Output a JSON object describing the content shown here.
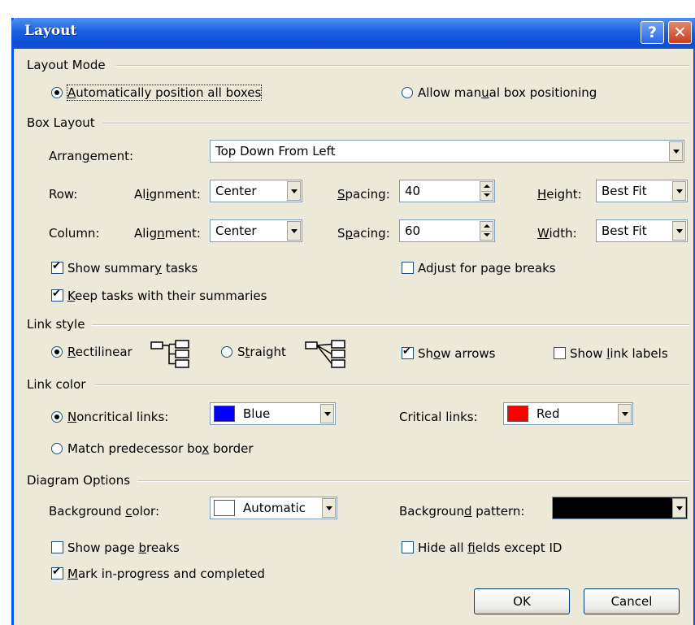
{
  "window": {
    "title": "Layout",
    "help_glyph": "?",
    "close_glyph": "✕"
  },
  "layout_mode": {
    "heading": "Layout Mode",
    "auto": {
      "pre": "",
      "key": "A",
      "post": "utomatically position all boxes",
      "selected": true
    },
    "manual": {
      "pre": "Allow man",
      "key": "u",
      "post": "al box positioning",
      "selected": false
    }
  },
  "box_layout": {
    "heading": "Box Layout",
    "arrangement": {
      "pre": "Arran",
      "key": "g",
      "post": "ement:",
      "value": "Top Down From Left"
    },
    "row": {
      "label": "Row:",
      "alignment": {
        "pre": "Al",
        "key": "i",
        "post": "gnment:",
        "value": "Center"
      },
      "spacing": {
        "pre": "",
        "key": "S",
        "post": "pacing:",
        "value": "40"
      },
      "size": {
        "pre": "",
        "key": "H",
        "post": "eight:",
        "value": "Best Fit"
      }
    },
    "column": {
      "label": "Column:",
      "alignment": {
        "pre": "Alig",
        "key": "n",
        "post": "ment:",
        "value": "Center"
      },
      "spacing": {
        "pre": "S",
        "key": "p",
        "post": "acing:",
        "value": "60"
      },
      "size": {
        "pre": "",
        "key": "W",
        "post": "idth:",
        "value": "Best Fit"
      }
    },
    "show_summary": {
      "pre": "Show summar",
      "key": "y",
      "post": " tasks",
      "checked": true
    },
    "keep_tasks": {
      "pre": "",
      "key": "K",
      "post": "eep tasks with their summaries",
      "checked": true
    },
    "adjust_breaks": {
      "pre": "Ad",
      "key": "j",
      "post": "ust for page breaks",
      "checked": false
    }
  },
  "link_style": {
    "heading": "Link style",
    "rectilinear": {
      "pre": "",
      "key": "R",
      "post": "ectilinear",
      "selected": true
    },
    "straight": {
      "pre": "S",
      "key": "t",
      "post": "raight",
      "selected": false
    },
    "show_arrows": {
      "pre": "Sh",
      "key": "o",
      "post": "w arrows",
      "checked": true
    },
    "show_labels": {
      "pre": "Show ",
      "key": "l",
      "post": "ink labels",
      "checked": false
    },
    "icons": [
      "rectilinear-link-icon",
      "straight-link-icon"
    ]
  },
  "link_color": {
    "heading": "Link color",
    "noncritical": {
      "pre": "",
      "key": "N",
      "post": "oncritical links:",
      "selected": true,
      "value": "Blue",
      "color": "#0000ff"
    },
    "critical": {
      "label": "Critical links:",
      "value": "Red",
      "color": "#ff0000"
    },
    "match": {
      "pre": "Match predecessor bo",
      "key": "x",
      "post": " border",
      "selected": false
    }
  },
  "diagram_options": {
    "heading": "Diagram Options",
    "bg_color": {
      "pre": "Background ",
      "key": "c",
      "post": "olor:",
      "value": "Automatic",
      "color": "#ffffff"
    },
    "bg_pattern": {
      "pre": "Backgroun",
      "key": "d",
      "post": " pattern:",
      "color": "#000000"
    },
    "show_page_breaks": {
      "pre": "Show page ",
      "key": "b",
      "post": "reaks",
      "checked": false
    },
    "hide_fields": {
      "pre": "Hide all ",
      "key": "f",
      "post": "ields except ID",
      "checked": false
    },
    "mark_progress": {
      "pre": "",
      "key": "M",
      "post": "ark in-progress and completed",
      "checked": true
    }
  },
  "buttons": {
    "ok": "OK",
    "cancel": "Cancel"
  }
}
